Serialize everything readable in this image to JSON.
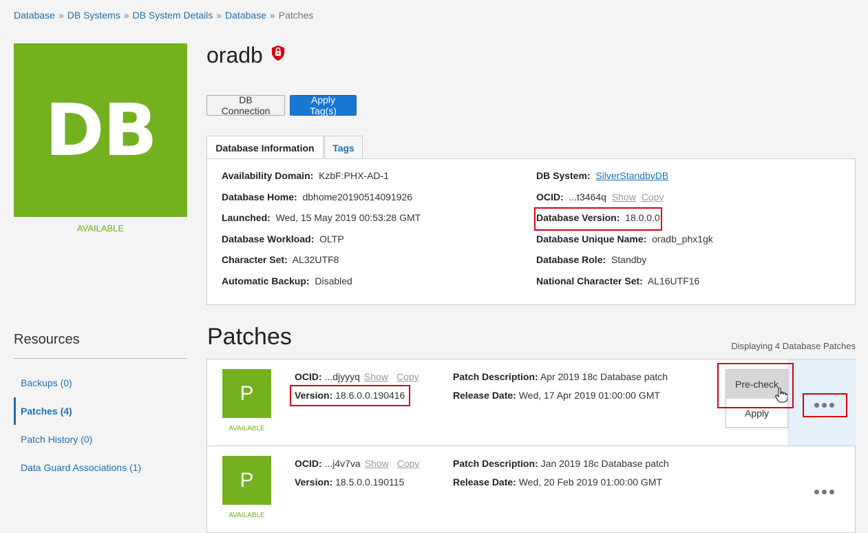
{
  "breadcrumb": [
    {
      "label": "Database"
    },
    {
      "label": "DB Systems"
    },
    {
      "label": "DB System Details"
    },
    {
      "label": "Database"
    },
    {
      "label": "Patches"
    }
  ],
  "breadcrumb_separator": "»",
  "db_tile": {
    "text": "DB",
    "status": "AVAILABLE",
    "color": "#73b11f"
  },
  "title": "oradb",
  "buttons": {
    "db_connection": "DB Connection",
    "apply_tags": "Apply Tag(s)"
  },
  "tabs": {
    "info": "Database Information",
    "tags": "Tags"
  },
  "info_left": [
    {
      "label": "Availability Domain:",
      "value": "KzbF:PHX-AD-1"
    },
    {
      "label": "Database Home:",
      "value": "dbhome20190514091926"
    },
    {
      "label": "Launched:",
      "value": "Wed, 15 May 2019 00:53:28 GMT"
    },
    {
      "label": "Database Workload:",
      "value": "OLTP"
    },
    {
      "label": "Character Set:",
      "value": "AL32UTF8"
    },
    {
      "label": "Automatic Backup:",
      "value": "Disabled"
    }
  ],
  "info_right": {
    "db_system": {
      "label": "DB System:",
      "value": "SilverStandbyDB"
    },
    "ocid": {
      "label": "OCID:",
      "value": "...t3464q",
      "show": "Show",
      "copy": "Copy"
    },
    "db_version": {
      "label": "Database Version:",
      "value": "18.0.0.0"
    },
    "unique_name": {
      "label": "Database Unique Name:",
      "value": "oradb_phx1gk"
    },
    "role": {
      "label": "Database Role:",
      "value": "Standby"
    },
    "ncharset": {
      "label": "National Character Set:",
      "value": "AL16UTF16"
    }
  },
  "resources": {
    "title": "Resources",
    "items": [
      {
        "label": "Backups (0)"
      },
      {
        "label": "Patches (4)"
      },
      {
        "label": "Patch History (0)"
      },
      {
        "label": "Data Guard Associations (1)"
      }
    ]
  },
  "patches": {
    "title": "Patches",
    "count_text": "Displaying 4 Database Patches",
    "rows": [
      {
        "tile": "P",
        "status": "AVAILABLE",
        "ocid_label": "OCID:",
        "ocid": "...djyyyq",
        "show": "Show",
        "copy": "Copy",
        "version_label": "Version:",
        "version": "18.6.0.0.190416",
        "desc_label": "Patch Description:",
        "desc": "Apr 2019 18c Database patch",
        "release_label": "Release Date:",
        "release": "Wed, 17 Apr 2019 01:00:00 GMT"
      },
      {
        "tile": "P",
        "status": "AVAILABLE",
        "ocid_label": "OCID:",
        "ocid": "...j4v7va",
        "show": "Show",
        "copy": "Copy",
        "version_label": "Version:",
        "version": "18.5.0.0.190115",
        "desc_label": "Patch Description:",
        "desc": "Jan 2019 18c Database patch",
        "release_label": "Release Date:",
        "release": "Wed, 20 Feb 2019 01:00:00 GMT"
      }
    ]
  },
  "actions_menu": {
    "precheck": "Pre-check",
    "apply": "Apply"
  },
  "colors": {
    "accent": "#1877d2",
    "available": "#73b11f",
    "highlight": "#d9000d"
  }
}
